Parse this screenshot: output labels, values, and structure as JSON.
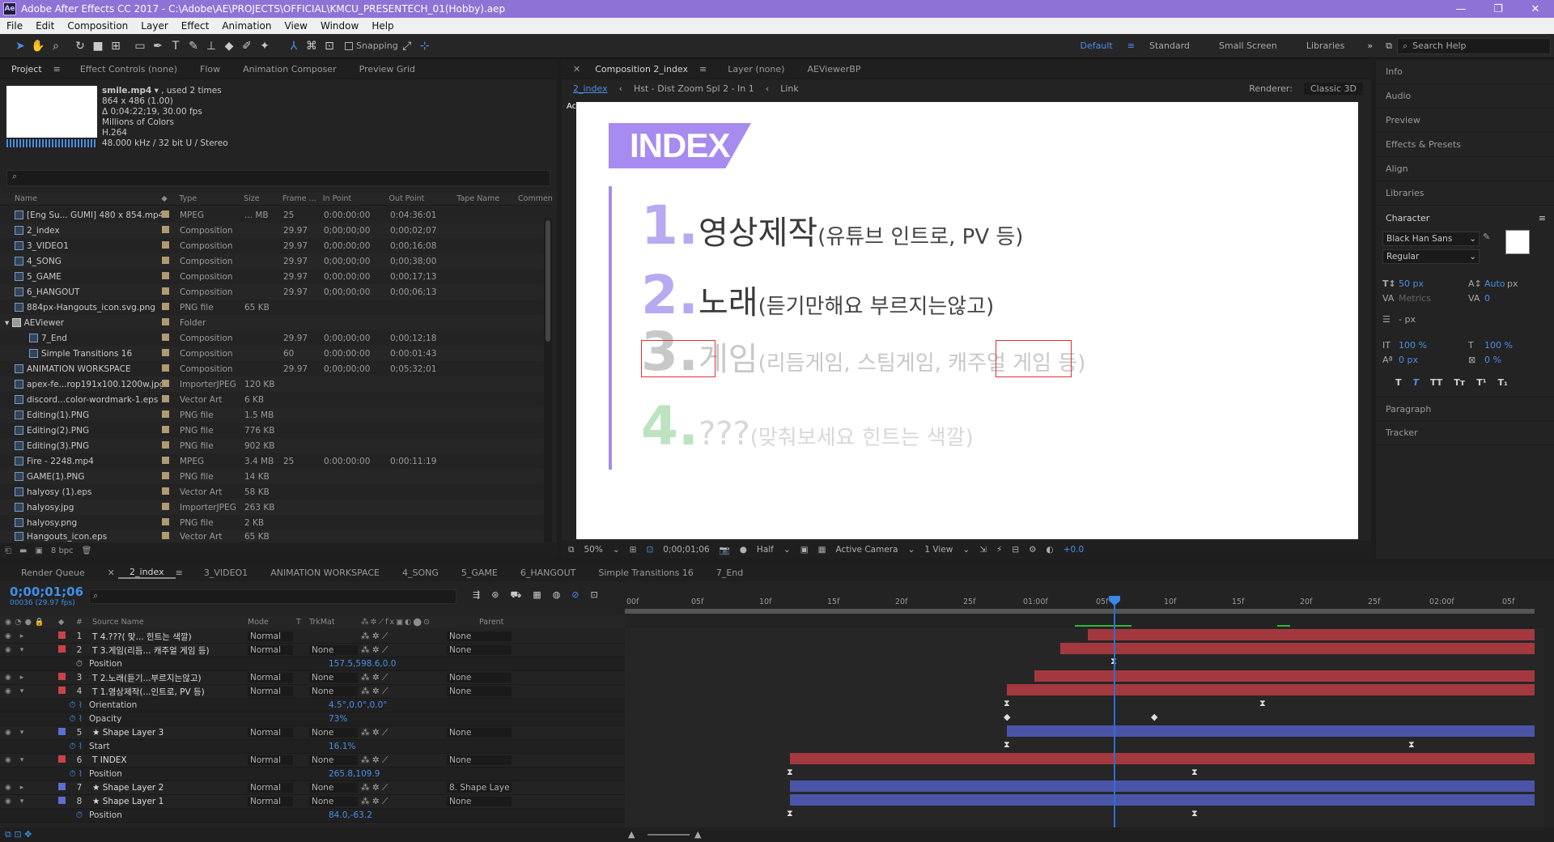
{
  "titlebar": {
    "title": "Adobe After Effects CC 2017 - C:\\Adobe\\AE\\PROJECTS\\OFFICIAL\\KMCU_PRESENTECH_01(Hobby).aep",
    "logo": "Ae"
  },
  "menu": [
    "File",
    "Edit",
    "Composition",
    "Layer",
    "Effect",
    "Animation",
    "View",
    "Window",
    "Help"
  ],
  "toolbar": {
    "snapping": "Snapping",
    "workspaces": [
      "Default",
      "Standard",
      "Small Screen",
      "Libraries"
    ],
    "search_placeholder": "Search Help"
  },
  "project": {
    "tabs": [
      "Project",
      "Effect Controls (none)",
      "Flow",
      "Animation Composer",
      "Preview Grid"
    ],
    "preview": {
      "name": "smile.mp4",
      "used": ", used 2 times",
      "dims": "864 x 486 (1.00)",
      "duration": "Δ 0;04:22;19, 30.00 fps",
      "colors": "Millions of Colors",
      "codec": "H.264",
      "audio": "48.000 kHz / 32 bit U / Stereo"
    },
    "columns": [
      "Name",
      "Type",
      "Size",
      "Frame ...",
      "In Point",
      "Out Point",
      "Tape Name",
      "Commen"
    ],
    "rows": [
      {
        "name": "[Eng Su... GUMI] 480 x 854.mp4",
        "type": "MPEG",
        "size": "... MB",
        "fr": "25",
        "in": "0:00:00:00",
        "out": "0:04:36:01"
      },
      {
        "name": "2_index",
        "type": "Composition",
        "size": "",
        "fr": "29.97",
        "in": "0;00;00;00",
        "out": "0;00;02;07"
      },
      {
        "name": "3_VIDEO1",
        "type": "Composition",
        "size": "",
        "fr": "29.97",
        "in": "0;00;00;00",
        "out": "0;00;16;08"
      },
      {
        "name": "4_SONG",
        "type": "Composition",
        "size": "",
        "fr": "29.97",
        "in": "0;00;00;00",
        "out": "0;00;38;00"
      },
      {
        "name": "5_GAME",
        "type": "Composition",
        "size": "",
        "fr": "29.97",
        "in": "0;00;00;00",
        "out": "0;00;17;13"
      },
      {
        "name": "6_HANGOUT",
        "type": "Composition",
        "size": "",
        "fr": "29.97",
        "in": "0;00;00;00",
        "out": "0;00;06;13"
      },
      {
        "name": "884px-Hangouts_icon.svg.png",
        "type": "PNG file",
        "size": "65 KB",
        "fr": "",
        "in": "",
        "out": ""
      },
      {
        "name": "AEViewer",
        "type": "Folder",
        "size": "",
        "fr": "",
        "in": "",
        "out": ""
      },
      {
        "name": "7_End",
        "type": "Composition",
        "size": "",
        "fr": "29.97",
        "in": "0;00;00;00",
        "out": "0;00;12;18"
      },
      {
        "name": "Simple Transitions 16",
        "type": "Composition",
        "size": "",
        "fr": "60",
        "in": "0:00:00:00",
        "out": "0:00:01:43"
      },
      {
        "name": "ANIMATION WORKSPACE",
        "type": "Composition",
        "size": "",
        "fr": "29.97",
        "in": "0;00;00;00",
        "out": "0;05;32;01"
      },
      {
        "name": "apex-fe...rop191x100.1200w.jpg",
        "type": "ImporterJPEG",
        "size": "120 KB",
        "fr": "",
        "in": "",
        "out": ""
      },
      {
        "name": "discord...color-wordmark-1.eps",
        "type": "Vector Art",
        "size": "6 KB",
        "fr": "",
        "in": "",
        "out": ""
      },
      {
        "name": "Editing(1).PNG",
        "type": "PNG file",
        "size": "1.5 MB",
        "fr": "",
        "in": "",
        "out": ""
      },
      {
        "name": "Editing(2).PNG",
        "type": "PNG file",
        "size": "776 KB",
        "fr": "",
        "in": "",
        "out": ""
      },
      {
        "name": "Editing(3).PNG",
        "type": "PNG file",
        "size": "902 KB",
        "fr": "",
        "in": "",
        "out": ""
      },
      {
        "name": "Fire - 2248.mp4",
        "type": "MPEG",
        "size": "3.4 MB",
        "fr": "25",
        "in": "0:00:00:00",
        "out": "0:00:11:19"
      },
      {
        "name": "GAME(1).PNG",
        "type": "PNG file",
        "size": "14 KB",
        "fr": "",
        "in": "",
        "out": ""
      },
      {
        "name": "halyosy (1).eps",
        "type": "Vector Art",
        "size": "58 KB",
        "fr": "",
        "in": "",
        "out": ""
      },
      {
        "name": "halyosy.jpg",
        "type": "ImporterJPEG",
        "size": "263 KB",
        "fr": "",
        "in": "",
        "out": ""
      },
      {
        "name": "halyosy.png",
        "type": "PNG file",
        "size": "2 KB",
        "fr": "",
        "in": "",
        "out": ""
      },
      {
        "name": "Hangouts_icon.eps",
        "type": "Vector Art",
        "size": "65 KB",
        "fr": "",
        "in": "",
        "out": ""
      }
    ],
    "footer_bpc": "8 bpc"
  },
  "comp": {
    "tabs": [
      "Composition 2_index",
      "Layer (none)",
      "AEViewerBP"
    ],
    "breadcrumb": [
      "2_index",
      "Hst - Dist Zoom Spl 2 - In 1",
      "Link"
    ],
    "renderer_label": "Renderer:",
    "renderer": "Classic 3D",
    "active_camera": "Active Camera",
    "canvas": {
      "banner": "INDEX",
      "items": [
        {
          "num": "1.",
          "main": "영상제작",
          "sub": "(유튜브 인트로, PV 등)"
        },
        {
          "num": "2.",
          "main": "노래",
          "sub": "(듣기만해요 부르지는않고)"
        },
        {
          "num": "3.",
          "main": "게임",
          "sub": "(리듬게임, 스팀게임, 캐주얼 게임 등)"
        },
        {
          "num": "4.",
          "main": "???",
          "sub": "(맞춰보세요 힌트는 색깔)"
        }
      ]
    },
    "footer": {
      "zoom": "50%",
      "timecode": "0;00;01;06",
      "resolution": "Half",
      "camera": "Active Camera",
      "views": "1 View",
      "exposure": "+0.0"
    }
  },
  "right_panel": {
    "items": [
      "Info",
      "Audio",
      "Preview",
      "Effects & Presets",
      "Align",
      "Libraries",
      "Character"
    ],
    "character": {
      "font": "Black Han Sans",
      "style": "Regular",
      "size": "50 px",
      "leading": "Auto",
      "leading_unit": "px",
      "kerning": "Metrics",
      "tracking": "0",
      "stroke_unit": "- px",
      "vscale": "100 %",
      "hscale": "100 %",
      "baseline": "0 px",
      "tsume": "0 %"
    },
    "lower": [
      "Paragraph",
      "Tracker"
    ]
  },
  "timeline": {
    "tabs": [
      "Render Queue",
      "2_index",
      "3_VIDEO1",
      "ANIMATION WORKSPACE",
      "4_SONG",
      "5_GAME",
      "6_HANGOUT",
      "Simple Transitions 16",
      "7_End"
    ],
    "timecode": "0;00;01;06",
    "fps": "00036 (29.97 fps)",
    "columns": [
      "#",
      "Source Name",
      "Mode",
      "T",
      "TrkMat",
      "Parent"
    ],
    "ruler": [
      "00f",
      "05f",
      "10f",
      "15f",
      "20f",
      "25f",
      "01:00f",
      "05f",
      "10f",
      "15f",
      "20f",
      "25f",
      "02:00f",
      "05f"
    ],
    "layers": [
      {
        "num": "1",
        "name": "T  4.???( 맞... 힌트는 색깔)",
        "mode": "Normal",
        "trk": "",
        "parent": "None",
        "color": "#c9424a"
      },
      {
        "num": "2",
        "name": "T  3.게임(리듬... 캐주얼 게임 등)",
        "mode": "Normal",
        "trk": "None",
        "parent": "None",
        "color": "#c9424a"
      },
      {
        "prop": "Position",
        "value": "157.5,598.6,0.0"
      },
      {
        "num": "3",
        "name": "T  2.노래(듣기...부르지는않고)",
        "mode": "Normal",
        "trk": "None",
        "parent": "None",
        "color": "#c9424a"
      },
      {
        "num": "4",
        "name": "T  1.영상제작(...인트로, PV 등)",
        "mode": "Normal",
        "trk": "None",
        "parent": "None",
        "color": "#c9424a"
      },
      {
        "prop": "Orientation",
        "value": "4.5°,0.0°,0.0°"
      },
      {
        "prop": "Opacity",
        "value": "73%"
      },
      {
        "num": "5",
        "name": "★  Shape Layer 3",
        "mode": "Normal",
        "trk": "None",
        "parent": "None",
        "color": "#5b6fd0"
      },
      {
        "prop": "Start",
        "value": "16.1%"
      },
      {
        "num": "6",
        "name": "T  INDEX",
        "mode": "Normal",
        "trk": "None",
        "parent": "None",
        "color": "#c9424a"
      },
      {
        "prop": "Position",
        "value": "265.8,109.9"
      },
      {
        "num": "7",
        "name": "★  Shape Layer 2",
        "mode": "Normal",
        "trk": "None",
        "parent": "8. Shape Laye",
        "color": "#5b6fd0"
      },
      {
        "num": "8",
        "name": "★  Shape Layer 1",
        "mode": "Normal",
        "trk": "None",
        "parent": "None",
        "color": "#5b6fd0"
      },
      {
        "prop": "Position",
        "value": "84.0,-63.2"
      }
    ]
  }
}
